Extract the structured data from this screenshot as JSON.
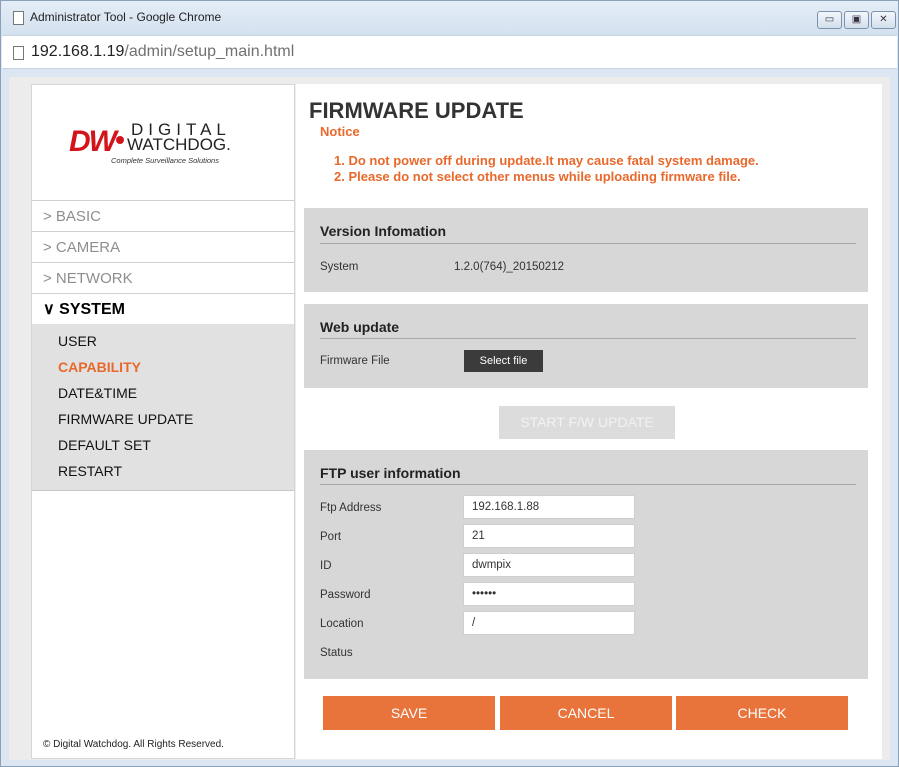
{
  "window": {
    "title": "Administrator Tool - Google Chrome",
    "url_host": "192.168.1.19",
    "url_path": "/admin/setup_main.html",
    "controls": {
      "minimize": "▭",
      "maximize": "▣",
      "close": "✕"
    }
  },
  "logo": {
    "mark": "DW",
    "name_top": "DIGITAL",
    "name_bottom": "WATCHDOG.",
    "tagline": "Complete Surveillance Solutions",
    "brand_color": "#d4141b"
  },
  "menu": {
    "items": [
      {
        "label": "> BASIC"
      },
      {
        "label": "> CAMERA"
      },
      {
        "label": "> NETWORK"
      },
      {
        "label": "∨ SYSTEM"
      }
    ],
    "submenu": [
      {
        "label": "USER"
      },
      {
        "label": "CAPABILITY"
      },
      {
        "label": "DATE&TIME"
      },
      {
        "label": "FIRMWARE UPDATE"
      },
      {
        "label": "DEFAULT SET"
      },
      {
        "label": "RESTART"
      }
    ],
    "highlight_color": "#e8692b"
  },
  "copyright": "© Digital Watchdog. All Rights Reserved.",
  "main": {
    "title": "FIRMWARE UPDATE",
    "notice_title": "Notice",
    "notices": [
      "1. Do not power off during update.It may cause fatal system damage.",
      "2. Please do not select other menus while uploading firmware file."
    ],
    "version": {
      "title": "Version Infomation",
      "label": "System",
      "value": "1.2.0(764)_20150212"
    },
    "web_update": {
      "title": "Web update",
      "label": "Firmware File",
      "button": "Select file"
    },
    "start_button": "START F/W UPDATE",
    "ftp": {
      "title": "FTP user information",
      "address_label": "Ftp Address",
      "address_value": "192.168.1.88",
      "port_label": "Port",
      "port_value": "21",
      "id_label": "ID",
      "id_value": "dwmpix",
      "password_label": "Password",
      "password_value": "••••••",
      "location_label": "Location",
      "location_value": "/",
      "status_label": "Status"
    },
    "buttons": {
      "save": "SAVE",
      "cancel": "CANCEL",
      "check": "CHECK",
      "color": "#e8733b"
    }
  }
}
